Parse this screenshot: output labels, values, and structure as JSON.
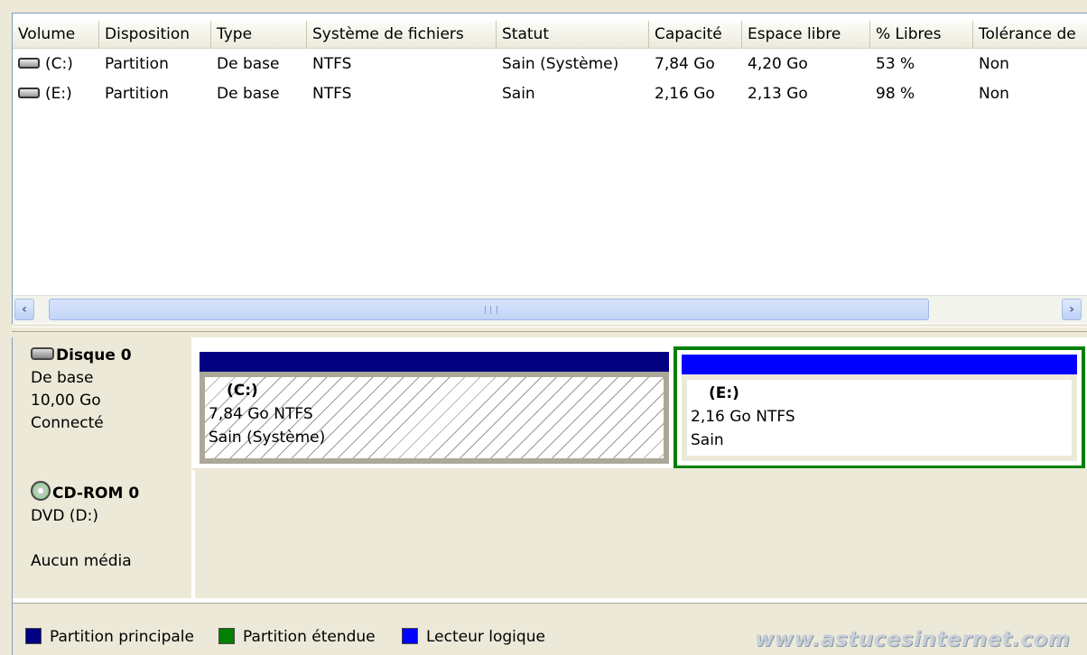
{
  "volume_list": {
    "columns": [
      "Volume",
      "Disposition",
      "Type",
      "Système de fichiers",
      "Statut",
      "Capacité",
      "Espace libre",
      "% Libres",
      "Tolérance de"
    ],
    "rows": [
      {
        "volume": "(C:)",
        "disposition": "Partition",
        "type": "De base",
        "filesystem": "NTFS",
        "status": "Sain (Système)",
        "capacity": "7,84 Go",
        "free": "4,20 Go",
        "pct_free": "53 %",
        "tolerance": "Non"
      },
      {
        "volume": "(E:)",
        "disposition": "Partition",
        "type": "De base",
        "filesystem": "NTFS",
        "status": "Sain",
        "capacity": "2,16 Go",
        "free": "2,13 Go",
        "pct_free": "98 %",
        "tolerance": "Non"
      }
    ],
    "row_icon": "drive-icon",
    "scrollbar": {
      "left_arrow": "‹",
      "right_arrow": "›"
    }
  },
  "disks": [
    {
      "name": "Disque 0",
      "type": "De base",
      "size": "10,00 Go",
      "state": "Connecté",
      "icon": "hard-disk-icon",
      "partitions": [
        {
          "label": "(C:)",
          "size_fs": "7,84 Go NTFS",
          "status": "Sain (Système)",
          "kind": "primary",
          "bar_color": "#000080"
        },
        {
          "label": "(E:)",
          "size_fs": "2,16 Go NTFS",
          "status": "Sain",
          "kind": "logical",
          "bar_color": "#0000FF",
          "frame_color": "#008000"
        }
      ]
    },
    {
      "name": "CD-ROM 0",
      "type": "DVD (D:)",
      "state": "Aucun média",
      "icon": "cd-rom-icon"
    }
  ],
  "legend": [
    {
      "label": "Partition principale",
      "color": "#000080"
    },
    {
      "label": "Partition étendue",
      "color": "#008000"
    },
    {
      "label": "Lecteur logique",
      "color": "#0000FF"
    }
  ],
  "watermark": "www.astucesinternet.com"
}
